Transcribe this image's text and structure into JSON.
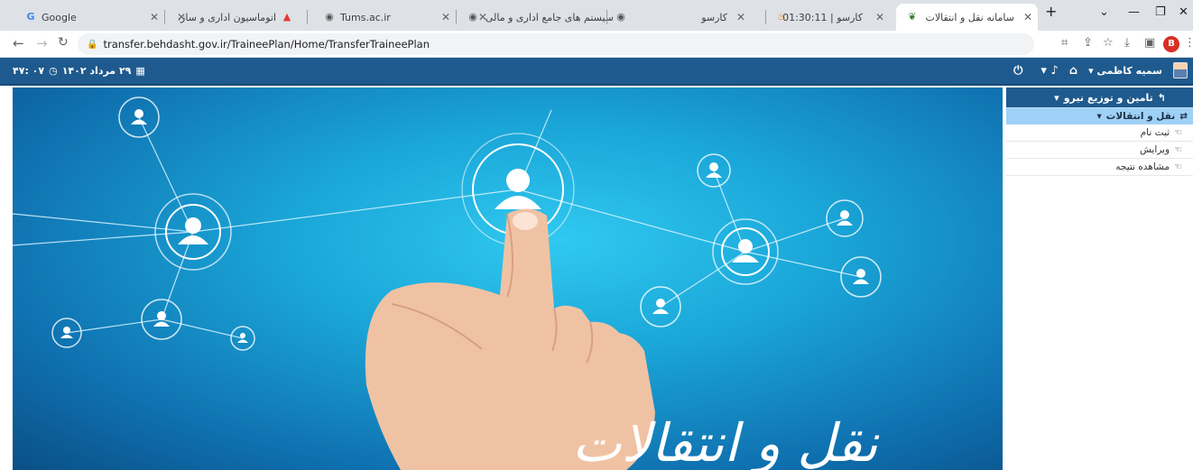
{
  "tabs": [
    {
      "title": "Google",
      "favicon": "G"
    },
    {
      "title": "اتوماسیون اداری و سازمان الکترونیک",
      "favicon": "house-icon"
    },
    {
      "title": "Tums.ac.ir",
      "favicon": "globe-icon"
    },
    {
      "title": "سیستم های جامع اداری و مالی",
      "favicon": "globe-icon"
    },
    {
      "title": "کارسو",
      "favicon": "fire-icon"
    },
    {
      "title": "کارسو | 01:30:11",
      "favicon": "leaf-icon"
    },
    {
      "title": "سامانه نقل و انتقالات",
      "favicon": "leaf-icon",
      "active": true
    }
  ],
  "new_tab_label": "+",
  "address": {
    "url": "transfer.behdasht.gov.ir/TraineePlan/Home/TransferTraineePlan"
  },
  "profile_letter": "B",
  "header": {
    "user_name": "سمیه کاظمی",
    "date": "۲۹ مرداد ۱۴۰۲",
    "time": "۰۷ :۴۷"
  },
  "sidebar": {
    "section_title": "تامین و توزیع نیرو",
    "group_label": "نقل و انتقالات",
    "items": [
      {
        "label": "ثبت نام"
      },
      {
        "label": "ویرایش"
      },
      {
        "label": "مشاهده نتیجه"
      }
    ]
  },
  "banner": {
    "title": "نقل و انتقالات"
  },
  "colors": {
    "header": "#1f5a8e",
    "menu_group": "#9fd0f5",
    "banner": "#1aa6d8"
  }
}
